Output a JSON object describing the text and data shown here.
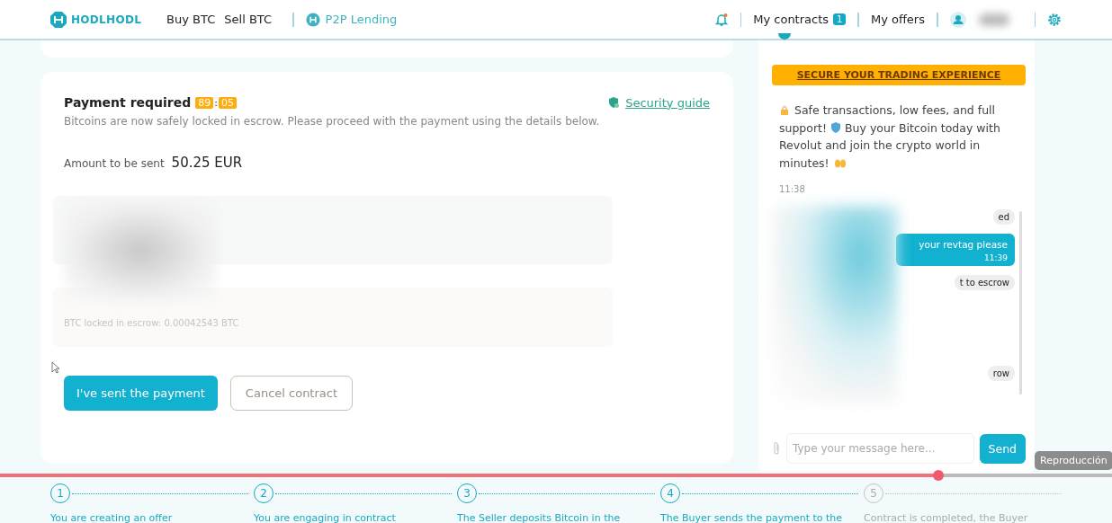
{
  "header": {
    "logo": "HODLHODL",
    "nav": [
      {
        "label": "Buy BTC"
      },
      {
        "label": "Sell BTC"
      }
    ],
    "lending": "P2P Lending",
    "contracts": {
      "label": "My contracts",
      "count": "1"
    },
    "offers": "My offers",
    "notification": true
  },
  "payment": {
    "title": "Payment required",
    "timer": {
      "minutes": "89",
      "separator": ":",
      "seconds": "05"
    },
    "guide": "Security guide",
    "subtitle": "Bitcoins are now safely locked in escrow. Please proceed with the payment using the details below.",
    "amount_label": "Amount to be sent",
    "amount": "50.25 EUR",
    "escrow_note": "BTC locked in escrow: 0.00042543 BTC",
    "primary_button": "I've sent the payment",
    "secondary_button": "Cancel contract"
  },
  "chat": {
    "banner": "SECURE YOUR TRADING EXPERIENCE",
    "promo": {
      "parts": [
        "Safe transactions, low fees, and full",
        "support!",
        "Buy your Bitcoin today with",
        "Revolut and join the crypto world in",
        "minutes!"
      ],
      "time": "11:38"
    },
    "messages": [
      {
        "kind": "system",
        "text": "ed"
      },
      {
        "kind": "outgoing",
        "text": "your revtag please",
        "time": "11:39"
      },
      {
        "kind": "system",
        "text": "t to escrow"
      },
      {
        "kind": "system",
        "text": "row"
      }
    ],
    "placeholder": "Type your message here...",
    "send": "Send"
  },
  "video": {
    "level": 0.844,
    "tooltip": "Reproducción"
  },
  "steps": [
    {
      "number": "1",
      "text": "You are creating an offer",
      "done": true
    },
    {
      "number": "2",
      "text": "You are engaging in contract",
      "done": true
    },
    {
      "number": "3",
      "text": "The Seller deposits Bitcoin in the",
      "done": true
    },
    {
      "number": "4",
      "text": "The Buyer sends the payment to the",
      "done": true
    },
    {
      "number": "5",
      "text": "Contract is completed, the Buyer",
      "done": false
    }
  ]
}
